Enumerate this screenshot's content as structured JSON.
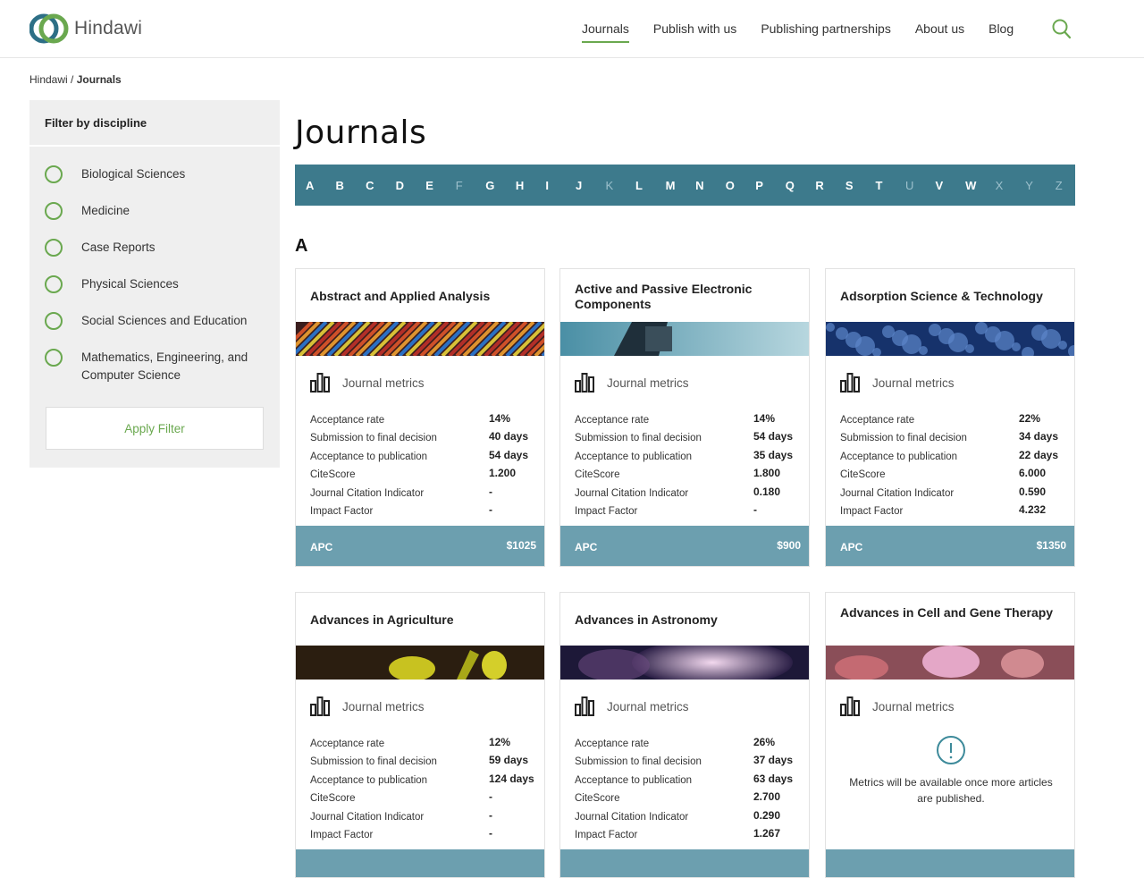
{
  "header": {
    "logo_text": "Hindawi",
    "nav": [
      "Journals",
      "Publish with us",
      "Publishing partnerships",
      "About us",
      "Blog"
    ],
    "active_nav": "Journals"
  },
  "breadcrumb": {
    "root": "Hindawi",
    "sep": " / ",
    "current": "Journals"
  },
  "sidebar": {
    "title": "Filter by discipline",
    "items": [
      "Biological Sciences",
      "Medicine",
      "Case Reports",
      "Physical Sciences",
      "Social Sciences and Education",
      "Mathematics, Engineering, and Computer Science"
    ],
    "apply_label": "Apply Filter"
  },
  "page_title": "Journals",
  "alphabet": {
    "letters": [
      "A",
      "B",
      "C",
      "D",
      "E",
      "F",
      "G",
      "H",
      "I",
      "J",
      "K",
      "L",
      "M",
      "N",
      "O",
      "P",
      "Q",
      "R",
      "S",
      "T",
      "U",
      "V",
      "W",
      "X",
      "Y",
      "Z"
    ],
    "disabled": [
      "F",
      "K",
      "U",
      "X",
      "Y",
      "Z"
    ]
  },
  "section_letter": "A",
  "metrics_heading": "Journal metrics",
  "metric_labels": [
    "Acceptance rate",
    "Submission to final decision",
    "Acceptance to publication",
    "CiteScore",
    "Journal Citation Indicator",
    "Impact Factor"
  ],
  "apc_label": "APC",
  "cards": [
    {
      "title": "Abstract and Applied Analysis",
      "values": [
        "14%",
        "40 days",
        "54 days",
        "1.200",
        "-",
        "-"
      ],
      "apc": "$1025"
    },
    {
      "title": "Active and Passive Electronic Components",
      "values": [
        "14%",
        "54 days",
        "35 days",
        "1.800",
        "0.180",
        "-"
      ],
      "apc": "$900"
    },
    {
      "title": "Adsorption Science & Technology",
      "values": [
        "22%",
        "34 days",
        "22 days",
        "6.000",
        "0.590",
        "4.232"
      ],
      "apc": "$1350"
    },
    {
      "title": "Advances in Agriculture",
      "values": [
        "12%",
        "59 days",
        "124 days",
        "-",
        "-",
        "-"
      ],
      "apc": ""
    },
    {
      "title": "Advances in Astronomy",
      "values": [
        "26%",
        "37 days",
        "63 days",
        "2.700",
        "0.290",
        "1.267"
      ],
      "apc": ""
    },
    {
      "title": "Advances in Cell and Gene Therapy",
      "values": [],
      "apc": "",
      "notice": "Metrics will be available once more articles are published."
    }
  ],
  "colors": {
    "accent_green": "#6aa84f",
    "alphabet_bar": "#3d7a8c",
    "apc_bar": "#6c9faf",
    "sidebar_bg": "#efefef"
  },
  "icons": [
    "search-icon",
    "bar-chart-icon",
    "info-alert-icon"
  ]
}
